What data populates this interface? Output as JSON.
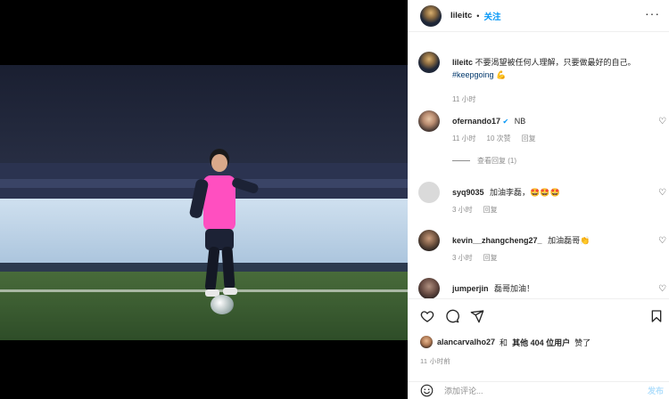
{
  "post": {
    "username": "lileitc",
    "dot": "•",
    "follow_label": "关注",
    "more": "···",
    "caption": "不要渴望被任何人理解，只要做最好的自己。",
    "hashtag": "#keepgoing",
    "caption_emoji": "💪",
    "caption_time": "11 小时"
  },
  "comments": [
    {
      "username": "ofernando17",
      "verified": "✔",
      "text": "NB",
      "time": "11 小时",
      "likes": "10 次赞",
      "reply": "回复",
      "view_replies": "查看回复 (1)"
    },
    {
      "username": "syq9035",
      "text": "加油李磊，🤩🤩🤩",
      "time": "3 小时",
      "reply": "回复"
    },
    {
      "username": "kevin__zhangcheng27_",
      "text": "加油磊哥👏",
      "time": "3 小时",
      "reply": "回复"
    },
    {
      "username": "jumperjin",
      "text": "磊哥加油！"
    }
  ],
  "actions": {
    "liked_by_user": "alancarvalho27",
    "liked_mid": "和",
    "liked_others": "其他 404 位用户",
    "liked_suffix": "赞了",
    "post_time": "11 小时前",
    "comment_placeholder": "添加评论...",
    "post_button": "发布"
  },
  "icons": [
    "more-icon",
    "heart-icon",
    "comment-icon",
    "share-icon",
    "bookmark-icon",
    "emoji-icon",
    "verified-icon"
  ]
}
